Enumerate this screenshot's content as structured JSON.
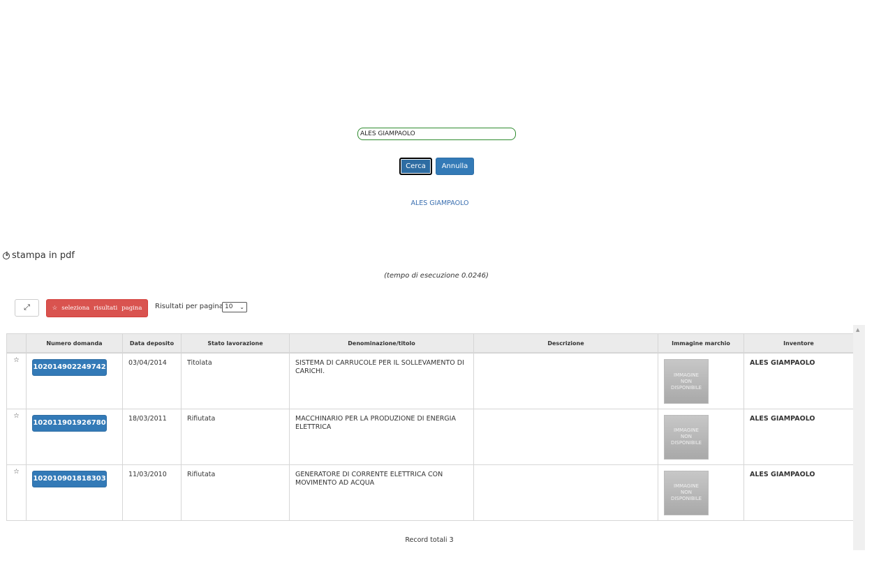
{
  "search": {
    "value": "ALES GIAMPAOLO"
  },
  "buttons": {
    "cerca": "Cerca",
    "annulla": "Annulla"
  },
  "author_link": "ALES GIAMPAOLO",
  "pdf_link": "stampa in pdf",
  "exec_time": "(tempo di esecuzione 0.0246)",
  "toolbar": {
    "select_star": "☆",
    "select_words": [
      "seleziona",
      "risultati",
      "pagina"
    ],
    "results_per_page_label": "Risultati per pagina:",
    "results_per_page_value": "10"
  },
  "table": {
    "headers": [
      "",
      "Numero domanda",
      "Data deposito",
      "Stato lavorazione",
      "Denominazione/titolo",
      "Descrizione",
      "Immagine marchio",
      "Inventore"
    ],
    "rows": [
      {
        "star": "☆",
        "numero": "102014902249742",
        "data": "03/04/2014",
        "stato": "Titolata",
        "titolo": "SISTEMA DI CARRUCOLE PER IL SOLLEVAMENTO DI CARICHI.",
        "descrizione": "",
        "immagine": [
          "IMMAGINE",
          "NON",
          "DISPONIBILE"
        ],
        "inventore": "ALES GIAMPAOLO"
      },
      {
        "star": "☆",
        "numero": "102011901926780",
        "data": "18/03/2011",
        "stato": "Rifiutata",
        "titolo": "MACCHINARIO PER LA PRODUZIONE DI ENERGIA ELETTRICA",
        "descrizione": "",
        "immagine": [
          "IMMAGINE",
          "NON",
          "DISPONIBILE"
        ],
        "inventore": "ALES GIAMPAOLO"
      },
      {
        "star": "☆",
        "numero": "102010901818303",
        "data": "11/03/2010",
        "stato": "Rifiutata",
        "titolo": "GENERATORE DI CORRENTE ELETTRICA CON MOVIMENTO AD ACQUA",
        "descrizione": "",
        "immagine": [
          "IMMAGINE",
          "NON",
          "DISPONIBILE"
        ],
        "inventore": "ALES GIAMPAOLO"
      }
    ]
  },
  "total_records": "Record totali 3",
  "colors": {
    "primary": "#337ab7",
    "danger": "#d9534f",
    "input_border": "#2e8b2e"
  }
}
